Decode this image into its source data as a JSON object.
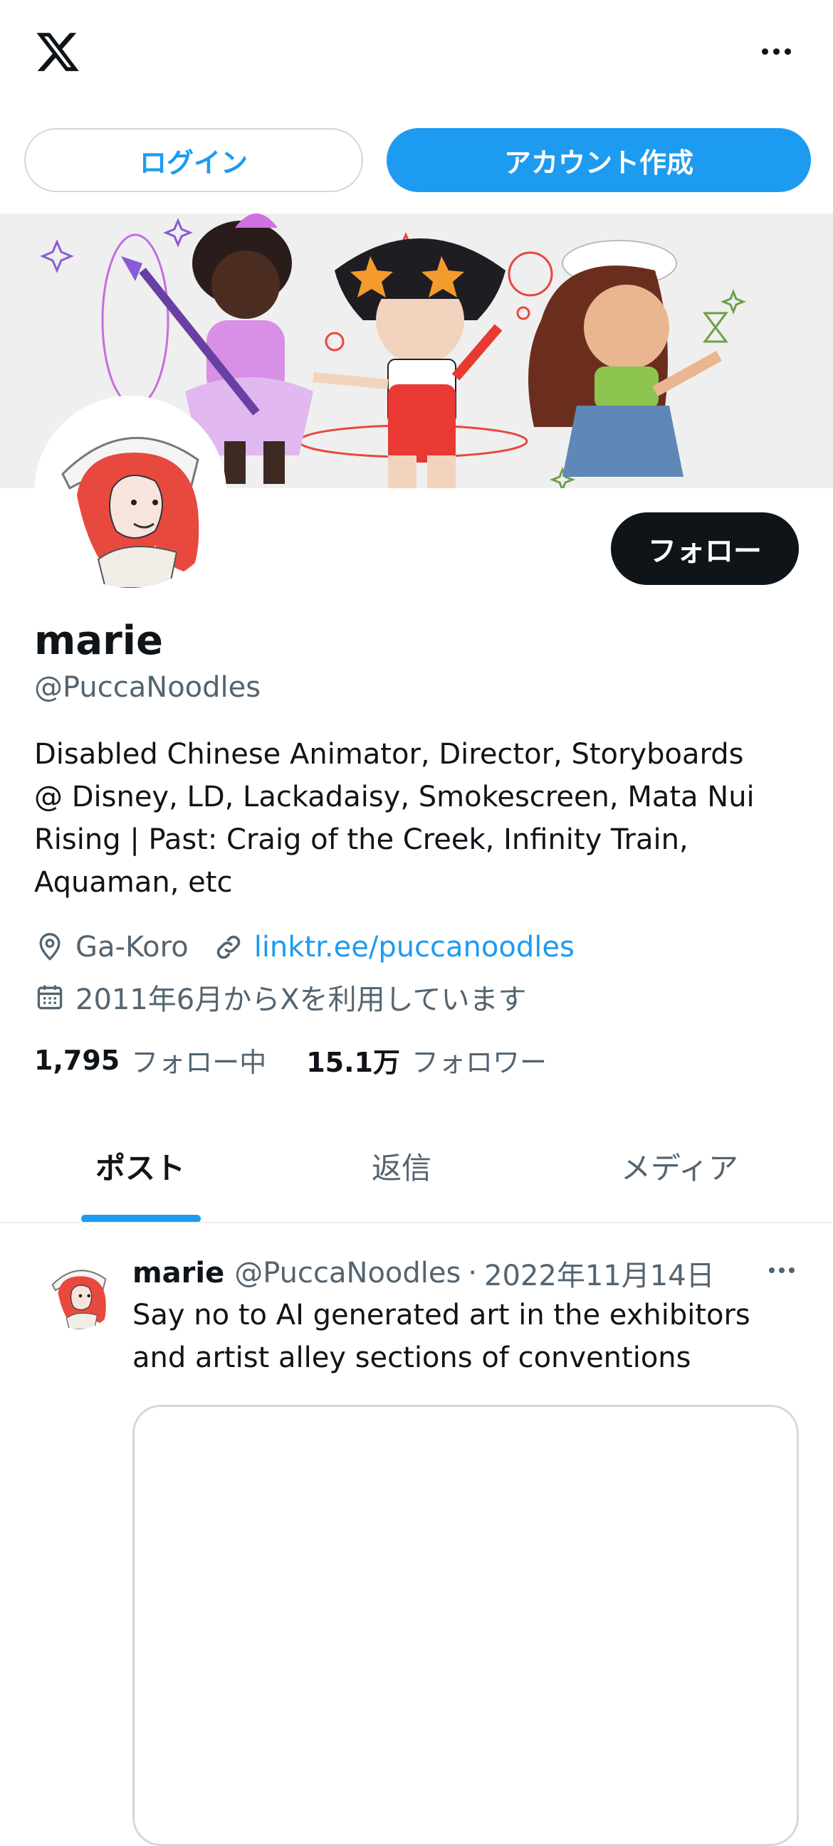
{
  "topbar": {
    "logo_icon": "x-logo-icon",
    "more_icon": "more-horizontal-icon"
  },
  "auth": {
    "login_label": "ログイン",
    "signup_label": "アカウント作成"
  },
  "profile": {
    "name": "marie",
    "handle": "@PuccaNoodles",
    "bio": "Disabled Chinese Animator, Director, Storyboards\n@ Disney, LD, Lackadaisy, Smokescreen, Mata Nui\nRising | Past: Craig of the Creek, Infinity Train,\nAquaman, etc",
    "location": "Ga-Koro",
    "website": "linktr.ee/puccanoodles",
    "joined": "2011年6月からXを利用しています",
    "follow_label": "フォロー",
    "following_count": "1,795",
    "following_label": "フォロー中",
    "followers_count": "15.1万",
    "followers_label": "フォロワー"
  },
  "tabs": [
    {
      "label": "ポスト",
      "active": true
    },
    {
      "label": "返信",
      "active": false
    },
    {
      "label": "メディア",
      "active": false
    }
  ],
  "post": {
    "author_name": "marie",
    "author_handle": "@PuccaNoodles",
    "separator": "·",
    "date": "2022年11月14日",
    "text": "Say no to AI generated art in the exhibitors and artist alley sections of conventions"
  },
  "colors": {
    "accent": "#1d9bf0",
    "text_primary": "#0f1419",
    "text_secondary": "#536471",
    "border": "#cfd9de"
  }
}
